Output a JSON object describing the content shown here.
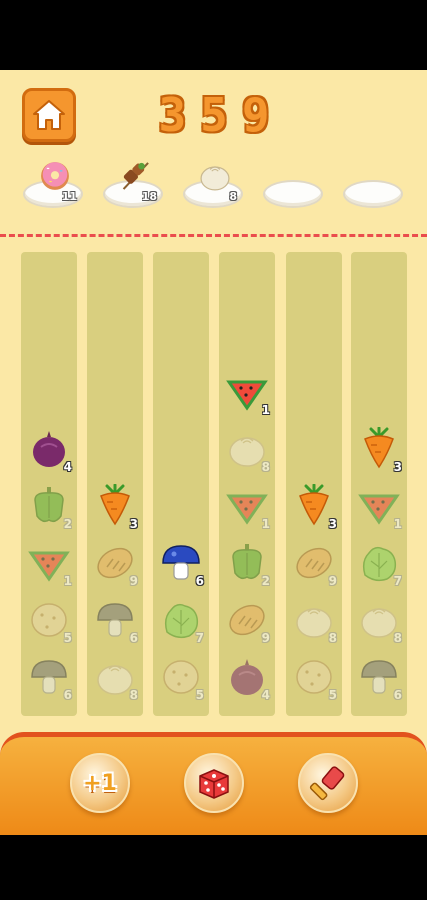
{
  "score": [
    "3",
    "5",
    "9"
  ],
  "plates": [
    {
      "item": "donut-icon",
      "count": "11"
    },
    {
      "item": "kebab-icon",
      "count": "18"
    },
    {
      "item": "bun-icon",
      "count": "8"
    },
    {
      "item": "",
      "count": ""
    },
    {
      "item": "",
      "count": ""
    }
  ],
  "columns": [
    {
      "tiles": [
        {
          "item": "onion-icon",
          "count": "4",
          "dim": false
        },
        {
          "item": "pepper-icon",
          "count": "2",
          "dim": true
        },
        {
          "item": "watermelon-icon",
          "count": "1",
          "dim": true
        },
        {
          "item": "potato-icon",
          "count": "5",
          "dim": true
        },
        {
          "item": "mushroom-icon",
          "count": "6",
          "dim": true
        }
      ]
    },
    {
      "tiles": [
        {
          "item": "carrot-icon",
          "count": "3",
          "dim": false
        },
        {
          "item": "bread-icon",
          "count": "9",
          "dim": true
        },
        {
          "item": "mushroom-icon",
          "count": "6",
          "dim": true
        },
        {
          "item": "bun-icon",
          "count": "8",
          "dim": true
        }
      ]
    },
    {
      "tiles": [
        {
          "item": "blue-mushroom-icon",
          "count": "6",
          "dim": false
        },
        {
          "item": "lettuce-icon",
          "count": "7",
          "dim": true
        },
        {
          "item": "potato-icon",
          "count": "5",
          "dim": true
        }
      ]
    },
    {
      "tiles": [
        {
          "item": "watermelon-icon",
          "count": "1",
          "dim": false
        },
        {
          "item": "bun-icon",
          "count": "8",
          "dim": true
        },
        {
          "item": "watermelon-icon",
          "count": "1",
          "dim": true
        },
        {
          "item": "pepper-icon",
          "count": "2",
          "dim": true
        },
        {
          "item": "bread-icon",
          "count": "9",
          "dim": true
        },
        {
          "item": "onion-icon",
          "count": "4",
          "dim": true
        }
      ]
    },
    {
      "tiles": [
        {
          "item": "carrot-icon",
          "count": "3",
          "dim": false
        },
        {
          "item": "bread-icon",
          "count": "9",
          "dim": true
        },
        {
          "item": "bun-icon",
          "count": "8",
          "dim": true
        },
        {
          "item": "potato-icon",
          "count": "5",
          "dim": true
        }
      ]
    },
    {
      "tiles": [
        {
          "item": "carrot-icon",
          "count": "3",
          "dim": false
        },
        {
          "item": "watermelon-icon",
          "count": "1",
          "dim": true
        },
        {
          "item": "lettuce-icon",
          "count": "7",
          "dim": true
        },
        {
          "item": "bun-icon",
          "count": "8",
          "dim": true
        },
        {
          "item": "mushroom-icon",
          "count": "6",
          "dim": true
        }
      ]
    }
  ],
  "tools": {
    "plus_one": "+1",
    "shuffle": "dice-icon",
    "hammer": "hammer-icon"
  },
  "colors": {
    "background": "#fbe8a6",
    "accent": "#f5962e",
    "dash": "#ea4d4d"
  }
}
